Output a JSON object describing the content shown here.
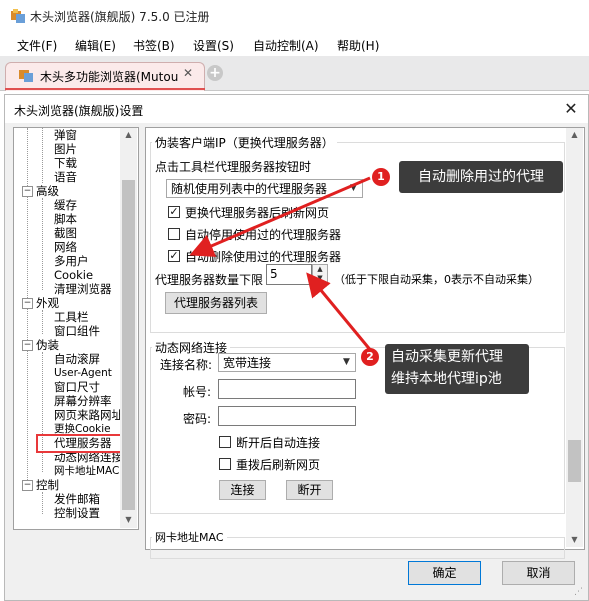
{
  "window": {
    "title": "木头浏览器(旗舰版) 7.5.0  已注册"
  },
  "menu": [
    "文件(F)",
    "编辑(E)",
    "书签(B)",
    "设置(S)",
    "自动控制(A)",
    "帮助(H)"
  ],
  "tab": {
    "label": "木头多功能浏览器(Mutou",
    "close": "✕",
    "add": "+"
  },
  "dialog": {
    "title": "木头浏览器(旗舰版)设置",
    "close": "✕",
    "ok": "确定",
    "cancel": "取消"
  },
  "tree": {
    "top_children": [
      "弹窗",
      "图片",
      "下载",
      "语音"
    ],
    "groups": [
      {
        "label": "高级",
        "children": [
          "缓存",
          "脚本",
          "截图",
          "网络",
          "多用户",
          "Cookie",
          "清理浏览器"
        ]
      },
      {
        "label": "外观",
        "children": [
          "工具栏",
          "窗口组件"
        ]
      },
      {
        "label": "伪装",
        "children": [
          "自动滚屏",
          "User-Agent",
          "窗口尺寸",
          "屏幕分辨率",
          "网页来路网址",
          "更换Cookie",
          "代理服务器",
          "动态网络连接",
          "网卡地址MAC"
        ]
      },
      {
        "label": "控制",
        "children": [
          "发件邮箱",
          "控制设置"
        ]
      }
    ],
    "selected": "代理服务器",
    "expander": "−"
  },
  "proxy": {
    "group_title": "伪装客户端IP（更换代理服务器）",
    "toolbar_label": "点击工具栏代理服务器按钮时",
    "mode": "随机使用列表中的代理服务器",
    "refresh_after_change": {
      "label": "更换代理服务器后刷新网页",
      "checked": true,
      "mark": "✓"
    },
    "auto_disable": {
      "label": "自动停用使用过的代理服务器",
      "checked": false,
      "mark": ""
    },
    "auto_delete": {
      "label": "自动删除使用过的代理服务器",
      "checked": true,
      "mark": "✓"
    },
    "lower_limit_label": "代理服务器数量下限",
    "lower_limit": "5",
    "lower_limit_note": "（低于下限自动采集，0表示不自动采集）",
    "list_button": "代理服务器列表"
  },
  "dialup": {
    "group_title": "动态网络连接",
    "conn_label": "连接名称:",
    "conn_value": "宽带连接",
    "account_label": "帐号:",
    "account_value": "",
    "password_label": "密码:",
    "password_value": "",
    "auto_reconnect": {
      "label": "断开后自动连接",
      "checked": false
    },
    "refresh_after_redial": {
      "label": "重拨后刷新网页",
      "checked": false
    },
    "connect_button": "连接",
    "disconnect_button": "断开"
  },
  "mac": {
    "group_title": "网卡地址MAC"
  },
  "annotations": [
    {
      "number": "1",
      "text": "自动删除用过的代理"
    },
    {
      "number": "2",
      "text_line1": "自动采集更新代理",
      "text_line2": "维持本地代理ip池"
    }
  ],
  "colors": {
    "accent_red": "#e02020",
    "callout_bg": "#3c3c3c",
    "selection_red": "#e8383a"
  }
}
